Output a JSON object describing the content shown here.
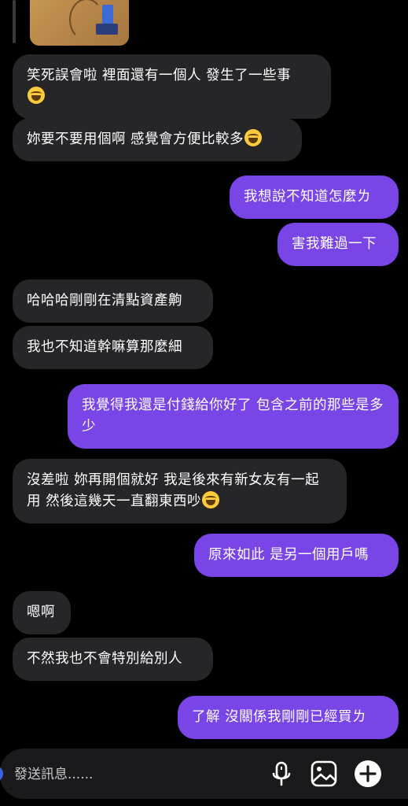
{
  "thread": {
    "messages": [
      {
        "side": "in",
        "text": "笑死誤會啦 裡面還有一個人 發生了一些事",
        "emoji": "joy-emoji"
      },
      {
        "side": "in",
        "text": "妳要不要用個啊 感覺會方便比較多",
        "emoji": "joy-emoji"
      },
      {
        "side": "out",
        "text": "我想說不知道怎麼ㄌ"
      },
      {
        "side": "out",
        "text": "害我難過一下"
      },
      {
        "side": "in",
        "text": "哈哈哈剛剛在清點資產齁"
      },
      {
        "side": "in",
        "text": "我也不知道幹嘛算那麼細"
      },
      {
        "side": "out",
        "text": "我覺得我還是付錢給你好了 包含之前的那些是多少"
      },
      {
        "side": "in",
        "text": "沒差啦 妳再開個就好 我是後來有新女友有一起用 然後這幾天一直翻東西吵",
        "emoji": "joy-emoji"
      },
      {
        "side": "out",
        "text": "原來如此 是另一個用戶嗎"
      },
      {
        "side": "in",
        "text": "嗯啊"
      },
      {
        "side": "in",
        "text": "不然我也不會特別給別人"
      },
      {
        "side": "out",
        "text": "了解 沒關係我剛剛已經買ㄌ"
      }
    ]
  },
  "composer": {
    "placeholder": "發送訊息......",
    "icons": [
      "microphone-icon",
      "gallery-icon",
      "plus-icon"
    ]
  },
  "colors": {
    "background": "#000000",
    "incoming_bubble": "#262628",
    "outgoing_bubble": "#7a45e6",
    "composer_background": "#1a1a1c"
  }
}
